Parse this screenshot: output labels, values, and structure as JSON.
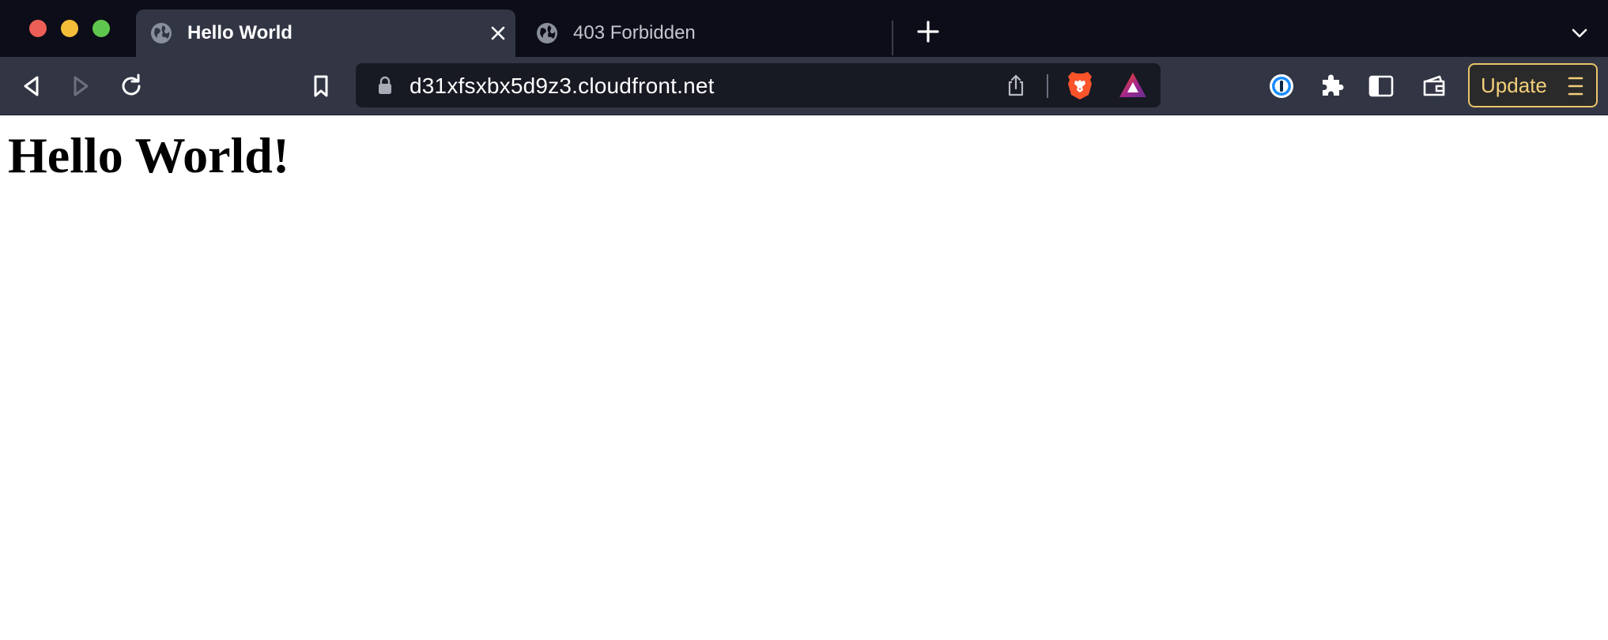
{
  "browser": {
    "tabs": [
      {
        "title": "Hello World",
        "active": true,
        "icon": "globe-icon"
      },
      {
        "title": "403 Forbidden",
        "active": false,
        "icon": "globe-icon"
      }
    ],
    "address_bar": {
      "url": "d31xfsxbx5d9z3.cloudfront.net",
      "security_icon": "lock-icon"
    },
    "toolbar_icons": [
      "back-icon",
      "forward-icon",
      "reload-icon",
      "bookmark-icon",
      "share-icon",
      "brave-shields-icon",
      "brave-rewards-icon",
      "password-manager-icon",
      "extensions-icon",
      "sidebar-icon",
      "wallet-icon",
      "menu-icon"
    ],
    "update_button": {
      "label": "Update"
    },
    "colors": {
      "tabstrip_bg": "#0c0d18",
      "toolbar_bg": "#323644",
      "omnibox_bg": "#171923",
      "update_accent": "#e9c46a",
      "brave_orange": "#fb542b"
    }
  },
  "page": {
    "heading": "Hello World!"
  }
}
